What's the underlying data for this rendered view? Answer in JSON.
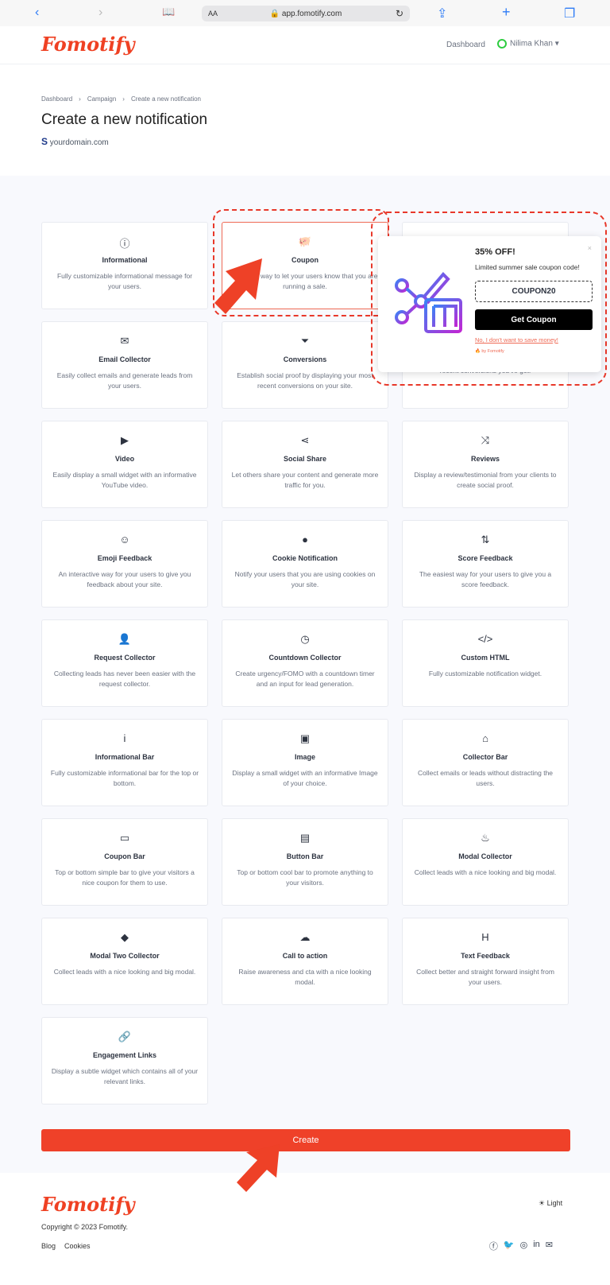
{
  "browser": {
    "url": "app.fomotify.com",
    "text_size": "AA",
    "back_icon": "‹",
    "forward_icon": "›",
    "bookmarks_icon": "📖",
    "reload_icon": "↻",
    "share_icon": "⇪",
    "new_tab_icon": "+",
    "tabs_icon": "❐"
  },
  "nav": {
    "logo": "Fomotify",
    "dashboard": "Dashboard",
    "user": "Nilima Khan",
    "caret": "▾"
  },
  "breadcrumb": [
    "Dashboard",
    "Campaign",
    "Create a new notification"
  ],
  "breadcrumb_sep": "›",
  "page": {
    "title": "Create a new notification",
    "domain_icon": "S",
    "domain": "yourdomain.com"
  },
  "cards": [
    {
      "title": "Informational",
      "desc": "Fully customizable informational message for your users.",
      "icon": "info-circle",
      "glyph": "ⓘ"
    },
    {
      "title": "Coupon",
      "desc": "The best way to let your users know that you are running a sale.",
      "icon": "piggy-bank",
      "glyph": "🐖",
      "selected": true
    },
    {
      "title": "",
      "desc": "",
      "icon": "",
      "glyph": ""
    },
    {
      "title": "Email Collector",
      "desc": "Easily collect emails and generate leads from your users.",
      "icon": "envelope-open",
      "glyph": "✉"
    },
    {
      "title": "Conversions",
      "desc": "Establish social proof by displaying your most recent conversions on your site.",
      "icon": "funnel-dollar",
      "glyph": "⏷"
    },
    {
      "title": "",
      "desc": "Establish social proof by showing how many recent conversions you've got.",
      "icon": "",
      "glyph": ""
    },
    {
      "title": "Video",
      "desc": "Easily display a small widget with an informative YouTube video.",
      "icon": "video",
      "glyph": "▶"
    },
    {
      "title": "Social Share",
      "desc": "Let others share your content and generate more traffic for you.",
      "icon": "share",
      "glyph": "⋖"
    },
    {
      "title": "Reviews",
      "desc": "Display a review/testimonial from your clients to create social proof.",
      "icon": "random",
      "glyph": "⤨"
    },
    {
      "title": "Emoji Feedback",
      "desc": "An interactive way for your users to give you feedback about your site.",
      "icon": "smile",
      "glyph": "☺"
    },
    {
      "title": "Cookie Notification",
      "desc": "Notify your users that you are using cookies on your site.",
      "icon": "cookie",
      "glyph": "●"
    },
    {
      "title": "Score Feedback",
      "desc": "The easiest way for your users to give you a score feedback.",
      "icon": "sort-numeric",
      "glyph": "⇅"
    },
    {
      "title": "Request Collector",
      "desc": "Collecting leads has never been easier with the request collector.",
      "icon": "user-plus",
      "glyph": "👤"
    },
    {
      "title": "Countdown Collector",
      "desc": "Create urgency/FOMO with a countdown timer and an input for lead generation.",
      "icon": "clock",
      "glyph": "◷"
    },
    {
      "title": "Custom HTML",
      "desc": "Fully customizable notification widget.",
      "icon": "code",
      "glyph": "</>"
    },
    {
      "title": "Informational Bar",
      "desc": "Fully customizable informational bar for the top or bottom.",
      "icon": "info",
      "glyph": "i"
    },
    {
      "title": "Image",
      "desc": "Display a small widget with an informative Image of your choice.",
      "icon": "image",
      "glyph": "▣"
    },
    {
      "title": "Collector Bar",
      "desc": "Collect emails or leads without distracting the users.",
      "icon": "inbox",
      "glyph": "⌂"
    },
    {
      "title": "Coupon Bar",
      "desc": "Top or bottom simple bar to give your visitors a nice coupon for them to use.",
      "icon": "ticket",
      "glyph": "▭"
    },
    {
      "title": "Button Bar",
      "desc": "Top or bottom cool bar to promote anything to your visitors.",
      "icon": "keyboard",
      "glyph": "▤"
    },
    {
      "title": "Modal Collector",
      "desc": "Collect leads with a nice looking and big modal.",
      "icon": "fire",
      "glyph": "♨"
    },
    {
      "title": "Modal Two Collector",
      "desc": "Collect leads with a nice looking and big modal.",
      "icon": "shapes",
      "glyph": "◆"
    },
    {
      "title": "Call to action",
      "desc": "Raise awareness and cta with a nice looking modal.",
      "icon": "cloud",
      "glyph": "☁"
    },
    {
      "title": "Text Feedback",
      "desc": "Collect better and straight forward insight from your users.",
      "icon": "heading",
      "glyph": "H"
    },
    {
      "title": "Engagement Links",
      "desc": "Display a subtle widget which contains all of your relevant links.",
      "icon": "link",
      "glyph": "🔗"
    }
  ],
  "create_label": "Create",
  "popup": {
    "heading": "35% OFF!",
    "subtitle": "Limited summer sale coupon code!",
    "code": "COUPON20",
    "button": "Get Coupon",
    "decline": "No, I don't want to save money!",
    "branding": "🔥 by Fomotify",
    "close": "×"
  },
  "footer": {
    "logo": "Fomotify",
    "copyright": "Copyright © 2023 Fomotify.",
    "links": [
      "Blog",
      "Cookies"
    ],
    "theme_icon": "☀",
    "theme": "Light",
    "social": [
      {
        "name": "facebook",
        "glyph": "ⓕ"
      },
      {
        "name": "twitter",
        "glyph": "🐦"
      },
      {
        "name": "instagram",
        "glyph": "◎"
      },
      {
        "name": "linkedin",
        "glyph": "in"
      },
      {
        "name": "email",
        "glyph": "✉"
      }
    ]
  },
  "colors": {
    "accent": "#ef4129",
    "annotation": "#e8382a"
  }
}
